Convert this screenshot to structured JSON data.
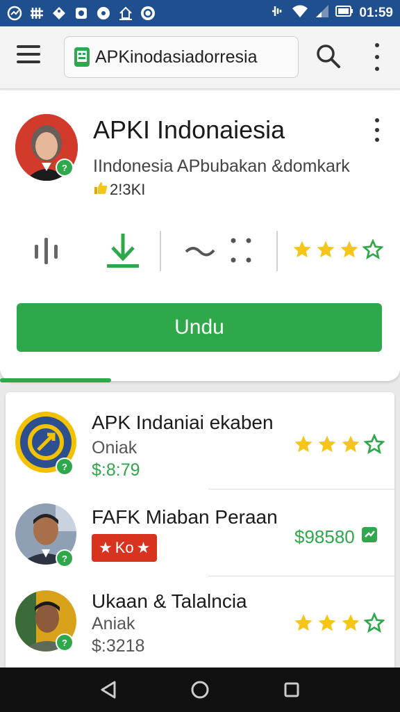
{
  "status_bar": {
    "time": "01:59",
    "icons": [
      "speed-icon",
      "grid-icon",
      "tag-icon",
      "square-icon",
      "circle-dot-icon",
      "home-icon",
      "app-icon"
    ],
    "signal_icon": "signal-icon",
    "wifi_icon": "wifi-icon",
    "battery_icon": "battery-icon"
  },
  "app_bar": {
    "menu_icon": "hamburger-icon",
    "url_text": "APKinodasiadorresia",
    "search_icon": "search-icon",
    "more_icon": "more-vert-icon"
  },
  "hero": {
    "title": "APKI Indonaiesia",
    "subtitle": "IIndonesia APbubakan &domkark",
    "likes": "2!3KI",
    "badge": "?",
    "button_label": "Undu",
    "rating_filled": 3,
    "rating_total": 4,
    "colors": {
      "accent": "#2ea84a",
      "star": "#f5c518"
    }
  },
  "list": [
    {
      "title": "APK Indaniai ekaben",
      "subtitle": "Oniak",
      "price": "$:8:79",
      "badge": "?",
      "rating_filled": 3,
      "rating_total": 4
    },
    {
      "title": "FAFK Miaban Peraan",
      "tag_label": "Ko",
      "price_right": "$98580",
      "badge": "?"
    },
    {
      "title": "Ukaan & Talalncia",
      "subtitle": "Aniak",
      "price": "$:3218",
      "badge": "?",
      "rating_filled": 3,
      "rating_total": 4
    }
  ],
  "nav_bar": {
    "back_icon": "back-triangle-icon",
    "home_icon": "home-circle-icon",
    "recents_icon": "recents-square-icon"
  }
}
